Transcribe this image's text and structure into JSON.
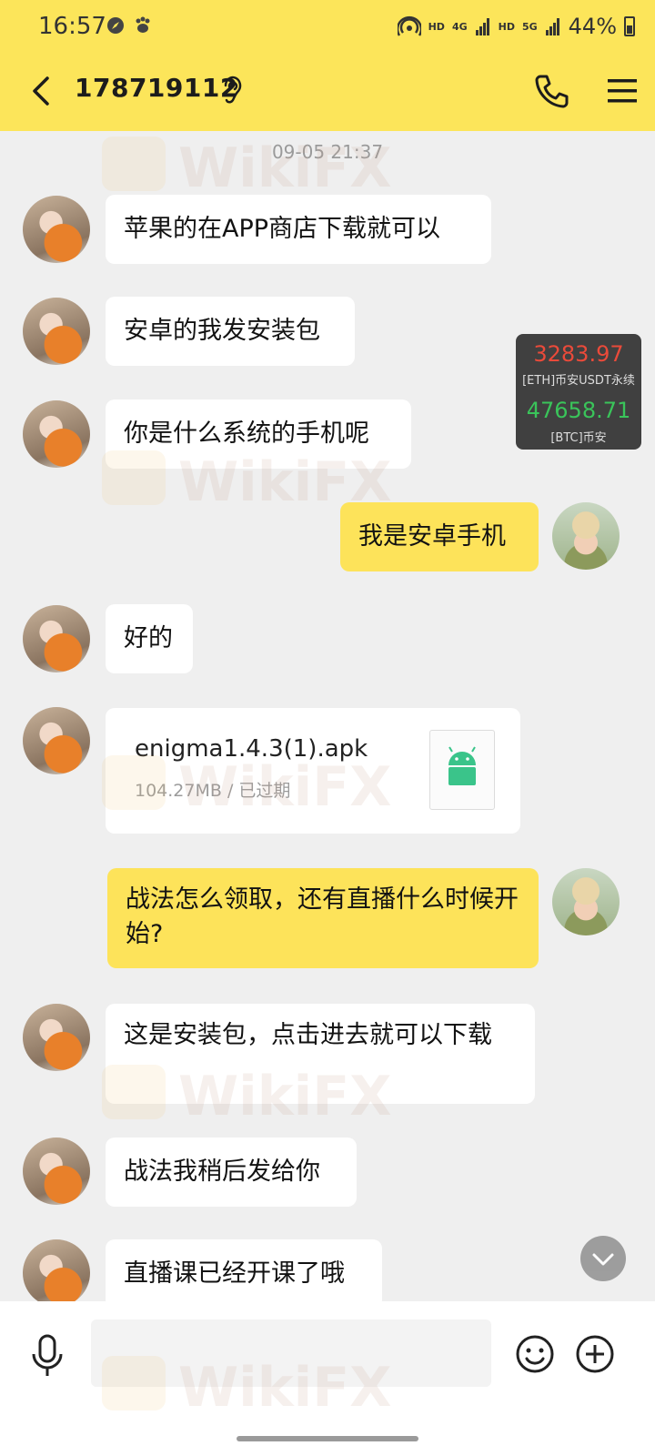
{
  "status_bar": {
    "time": "16:57",
    "network_left": "HD",
    "network_4g": "4G",
    "network_right": "HD",
    "network_5g": "5G",
    "battery": "44%"
  },
  "header": {
    "title": "178719112"
  },
  "timestamp": "09-05 21:37",
  "messages": [
    {
      "side": "left",
      "text": "苹果的在APP商店下载就可以"
    },
    {
      "side": "left",
      "text": "安卓的我发安装包"
    },
    {
      "side": "left",
      "text": "你是什么系统的手机呢"
    },
    {
      "side": "right",
      "text": "我是安卓手机"
    },
    {
      "side": "left",
      "text": "好的"
    },
    {
      "side": "left",
      "type": "file",
      "file_name": "enigma1.4.3(1).apk",
      "file_meta": "104.27MB / 已过期"
    },
    {
      "side": "right",
      "text": "战法怎么领取，还有直播什么时候开始?"
    },
    {
      "side": "left",
      "text": "这是安装包，点击进去就可以下载"
    },
    {
      "side": "left",
      "text": "战法我稍后发给你"
    },
    {
      "side": "left",
      "text": "直播课已经开课了哦"
    }
  ],
  "ticker": {
    "price1": "3283.97",
    "label1": "[ETH]币安USDT永续",
    "price2": "47658.71",
    "label2": "[BTC]币安",
    "color1": "#ea4a3a",
    "color2": "#3ac45a"
  },
  "watermark": "WikiFX",
  "colors": {
    "header_bg": "#fce55a",
    "my_bubble": "#fde35a",
    "their_bubble": "#ffffff",
    "chat_bg": "#efefef"
  },
  "icons": [
    "back-arrow-icon",
    "ear-icon",
    "phone-icon",
    "menu-icon",
    "android-icon",
    "chevron-down-icon",
    "mic-icon",
    "emoji-icon",
    "plus-icon"
  ]
}
